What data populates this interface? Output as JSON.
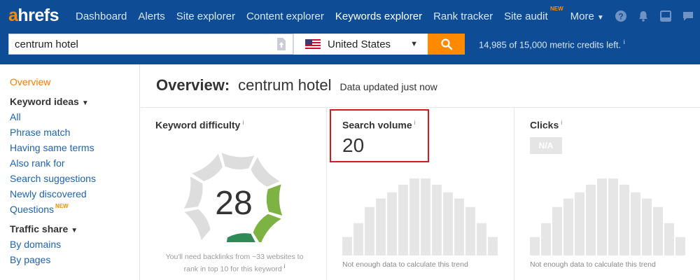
{
  "nav": {
    "logo_a": "a",
    "logo_rest": "hrefs",
    "items": [
      {
        "label": "Dashboard"
      },
      {
        "label": "Alerts"
      },
      {
        "label": "Site explorer"
      },
      {
        "label": "Content explorer"
      },
      {
        "label": "Keywords explorer",
        "active": true
      },
      {
        "label": "Rank tracker"
      },
      {
        "label": "Site audit",
        "badge": "NEW"
      },
      {
        "label": "More"
      }
    ],
    "icons": [
      "help-icon",
      "bell-icon",
      "window-icon",
      "chat-icon"
    ]
  },
  "search": {
    "value": "centrum hotel",
    "country": "United States",
    "credits": "14,985 of 15,000 metric credits left.",
    "credits_info": "i"
  },
  "sidebar": {
    "overview": "Overview",
    "keyword_ideas": "Keyword ideas",
    "keyword_items": [
      "All",
      "Phrase match",
      "Having same terms",
      "Also rank for",
      "Search suggestions",
      "Newly discovered",
      "Questions"
    ],
    "questions_badge": "NEW",
    "traffic_share": "Traffic share",
    "traffic_items": [
      "By domains",
      "By pages"
    ]
  },
  "overview": {
    "prefix": "Overview:",
    "keyword": "centrum hotel",
    "updated": "Data updated just now"
  },
  "cards": {
    "kd": {
      "title": "Keyword difficulty",
      "info": "i",
      "value": "28",
      "value_num": 28,
      "note_line1": "You'll need backlinks from ~33 websites to",
      "note_line2": "rank in top 10 for this keyword",
      "note_info": "i"
    },
    "sv": {
      "title": "Search volume",
      "info": "i",
      "value": "20",
      "trend_note": "Not enough data to calculate this trend"
    },
    "clicks": {
      "title": "Clicks",
      "info": "i",
      "na": "N/A",
      "trend_note": "Not enough data to calculate this trend"
    }
  },
  "colors": {
    "nav_bg": "#0f4c96",
    "accent": "#ff8a00",
    "link": "#1e62b3",
    "gauge_light_green": "#7cb342",
    "gauge_dark_green": "#2e8b57",
    "gauge_track": "#dddddd",
    "placeholder_bar": "#e6e6e6",
    "highlight": "#e0161c"
  },
  "placeholder_trend": [
    0.24,
    0.42,
    0.63,
    0.74,
    0.82,
    0.92,
    1.0,
    1.0,
    0.92,
    0.82,
    0.74,
    0.63,
    0.42,
    0.24
  ]
}
